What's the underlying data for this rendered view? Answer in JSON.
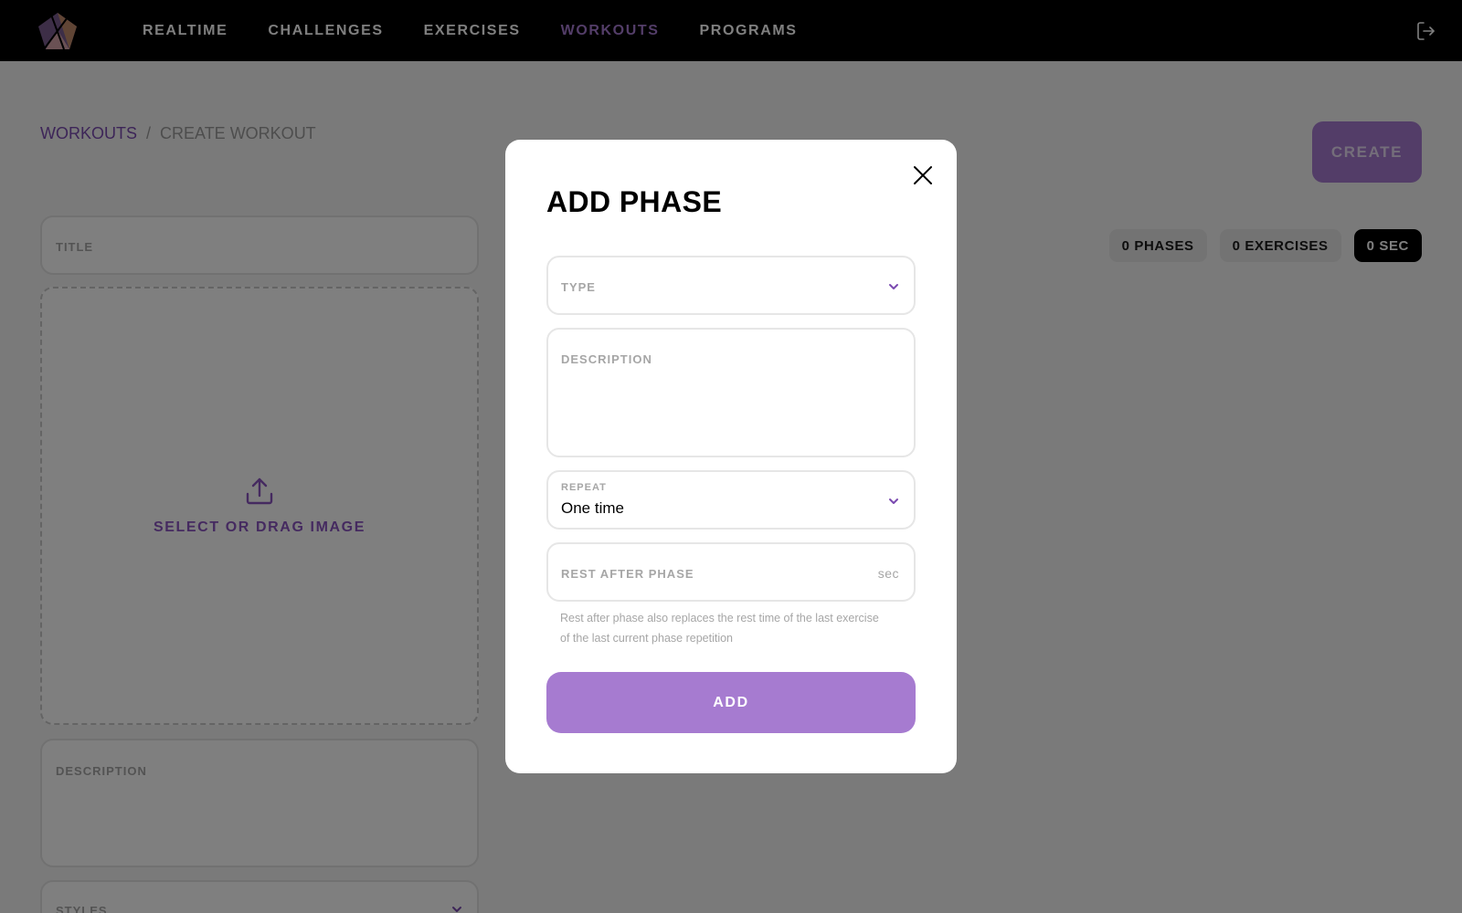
{
  "nav": {
    "items": [
      {
        "label": "REALTIME",
        "active": false
      },
      {
        "label": "CHALLENGES",
        "active": false
      },
      {
        "label": "EXERCISES",
        "active": false
      },
      {
        "label": "WORKOUTS",
        "active": true
      },
      {
        "label": "PROGRAMS",
        "active": false
      }
    ]
  },
  "breadcrumb": {
    "parent": "WORKOUTS",
    "separator": "/",
    "current": "CREATE WORKOUT"
  },
  "toolbar": {
    "create_label": "CREATE"
  },
  "stats": {
    "phases": "0 PHASES",
    "exercises": "0 EXERCISES",
    "duration": "0 SEC"
  },
  "form": {
    "title_label": "TITLE",
    "image_label": "SELECT OR DRAG IMAGE",
    "description_label": "DESCRIPTION",
    "styles_label": "STYLES"
  },
  "modal": {
    "title": "ADD PHASE",
    "type_label": "TYPE",
    "description_label": "DESCRIPTION",
    "repeat_label": "REPEAT",
    "repeat_value": "One time",
    "rest_label": "REST AFTER PHASE",
    "rest_unit": "sec",
    "rest_hint": "Rest after phase also replaces the rest time of the last exercise of the last current phase repetition",
    "add_label": "ADD"
  },
  "colors": {
    "accent": "#a67bd0",
    "nav_bg": "#000000",
    "link": "#7a4ab0"
  },
  "icons": {
    "logo": "pentagon-logo",
    "logout": "logout-icon",
    "upload": "upload-icon",
    "close": "close-icon",
    "chevron": "chevron-down-icon"
  }
}
